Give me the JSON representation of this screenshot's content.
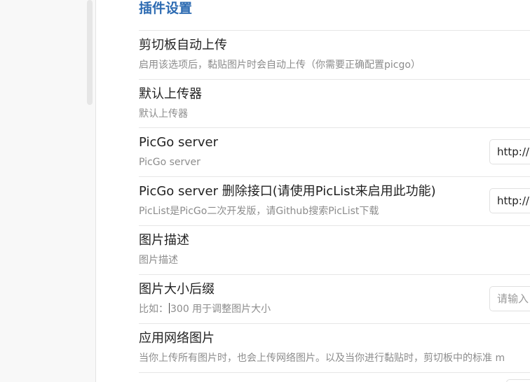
{
  "settings": {
    "section_title": "插件设置",
    "rows": [
      {
        "title": "剪切板自动上传",
        "desc": "启用该选项后，黏贴图片时会自动上传（你需要正确配置picgo）"
      },
      {
        "title": "默认上传器",
        "desc": "默认上传器"
      },
      {
        "title": "PicGo server",
        "desc": "PicGo server",
        "input_value": "http://"
      },
      {
        "title": "PicGo server 删除接口(请使用PicList来启用此功能)",
        "desc": "PicList是PicGo二次开发版，请Github搜索PicList下载",
        "input_value": "http://"
      },
      {
        "title": "图片描述",
        "desc": "图片描述"
      },
      {
        "title": "图片大小后缀",
        "desc_prefix": "比如：",
        "desc_suffix": "300 用于调整图片大小",
        "input_placeholder": "请输入"
      },
      {
        "title": "应用网络图片",
        "desc": "当你上传所有图片时，也会上传网络图片。以及当你进行黏贴时，剪切板中的标准 m"
      }
    ]
  }
}
